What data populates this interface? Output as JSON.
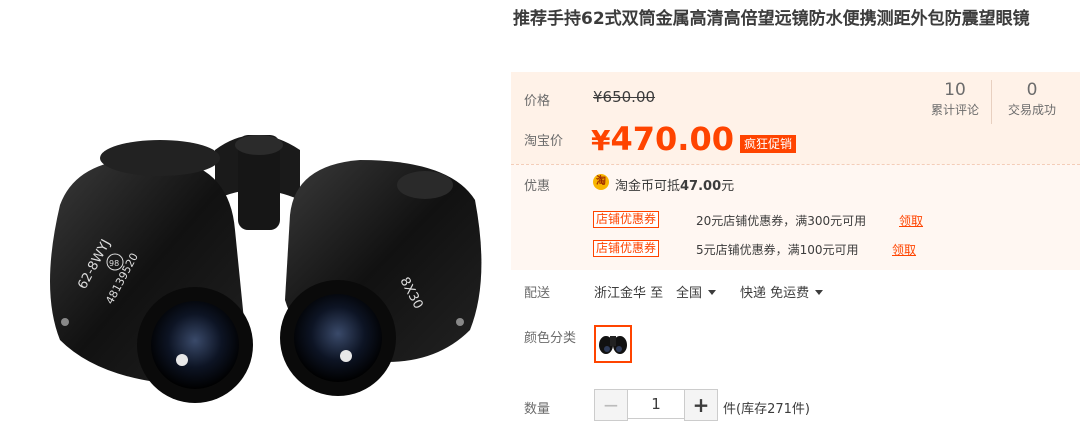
{
  "product": {
    "title": "推荐手持62式双筒金属高清高倍望远镜防水便携测距外包防震望眼镜"
  },
  "price": {
    "label": "价格",
    "original": "¥650.00",
    "tb_label": "淘宝价",
    "currency": "¥",
    "current": "470.00",
    "promo_tag": "疯狂促销"
  },
  "stats": [
    {
      "value": "10",
      "label": "累计评论"
    },
    {
      "value": "0",
      "label": "交易成功"
    }
  ],
  "promotions": {
    "label": "优惠",
    "coin_icon": "淘",
    "coin_text_prefix": "淘金币可抵",
    "coin_amount": "47.00",
    "coin_suffix": "元",
    "coupons": [
      {
        "tag": "店铺优惠券",
        "text": "20元店铺优惠券，满300元可用",
        "action": "领取"
      },
      {
        "tag": "店铺优惠券",
        "text": "5元店铺优惠券，满100元可用",
        "action": "领取"
      }
    ]
  },
  "delivery": {
    "label": "配送",
    "from": "浙江金华 至",
    "to": "全国",
    "shipping": "快递 免运费"
  },
  "color": {
    "label": "颜色分类"
  },
  "quantity": {
    "label": "数量",
    "minus": "−",
    "value": "1",
    "plus": "+",
    "stock": "件(库存271件)"
  },
  "image": {
    "left_text": "62-8WYJ",
    "serial": "48139520",
    "badge": "98",
    "spec": "8X30"
  },
  "colors": {
    "accent": "#ff4400",
    "price_bg": "#fff2e8"
  }
}
